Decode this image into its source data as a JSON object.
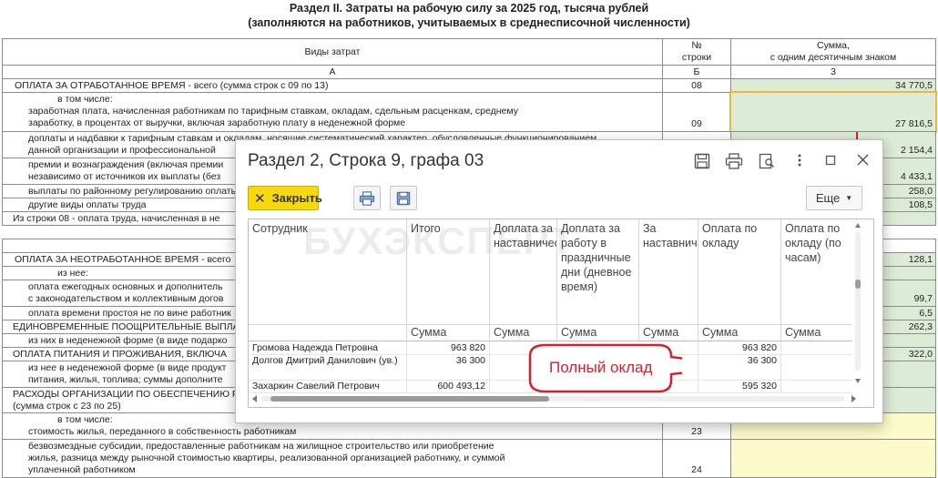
{
  "report": {
    "title_line1": "Раздел II. Затраты на рабочую силу за 2025 год, тысяча рублей",
    "title_line2": "(заполняются на работников, учитываемых в среднесписочной численности)",
    "header": {
      "col_a": "Виды затрат",
      "col_b_line1": "№",
      "col_b_line2": "строки",
      "col_c_line1": "Сумма,",
      "col_c_line2": "с одним десятичным знаком",
      "code_a": "А",
      "code_b": "Б",
      "code_c": "3"
    },
    "rows": {
      "r08": {
        "label": "ОПЛАТА ЗА ОТРАБОТАННОЕ ВРЕМЯ - всего (сумма строк с 09 по 13)",
        "code": "08",
        "value": "34 770,5"
      },
      "r_incl": "в том числе:",
      "r09_l1": "заработная плата, начисленная работникам по тарифным ставкам, окладам, сдельным расценкам, среднему",
      "r09_l2": "заработку, в процентах от выручки, включая заработную плату в неденежной форме",
      "r09_code": "09",
      "r09_value": "27 816,5",
      "r10_l1": "доплаты и надбавки к тарифным ставкам и окладам, носящие систематический характер, обусловленные функционированием",
      "r10_l2": "данной организации и профессиональной",
      "r10_value": "2 154,4",
      "r11_l1": "премии и вознаграждения (включая премии",
      "r11_l2": "независимо от источников их выплаты (без",
      "r11_value": "4 433,1",
      "r12": "выплаты по районному регулированию оплаты",
      "r12_value": "258,0",
      "r13": "другие виды оплаты труда",
      "r13_value": "108,5",
      "r14": "Из строки 08 - оплата труда, начисленная в не",
      "b2_r1": "ОПЛАТА ЗА НЕОТРАБОТАННОЕ ВРЕМЯ - всего",
      "b2_r1_value": "128,1",
      "b2_r2": "из нее:",
      "b2_r3_l1": "оплата ежегодных основных и дополнитель",
      "b2_r3_l2": "с законодательством и коллективным догов",
      "b2_r3_value": "99,7",
      "b2_r4": "оплата времени простоя не по вине работник",
      "b2_r4_value": "6,5",
      "b2_r5": "ЕДИНОВРЕМЕННЫЕ ПООЩРИТЕЛЬНЫЕ ВЫПЛАТ",
      "b2_r5_value": "262,3",
      "b2_r6": "из них в неденежной форме (в виде подарко",
      "b2_r7": "ОПЛАТА ПИТАНИЯ И ПРОЖИВАНИЯ, ВКЛЮЧА",
      "b2_r7_value": "322,0",
      "b2_r8_l1": "из нее в неденежной форме (в виде продукт",
      "b2_r8_l2": "питания, жилья, топлива; суммы дополните",
      "b2_r9_l1": "РАСХОДЫ ОРГАНИЗАЦИИ ПО ОБЕСПЕЧЕНИЮ Р",
      "b2_r9_l2": "(сумма строк с 23 по 25)",
      "b2_r10": "в том числе:",
      "b2_r11": "стоимость жилья, переданного в собственность работникам",
      "b2_r11_code": "23",
      "b2_r12_l1": "безвозмездные субсидии, предоставленные работникам на жилищное строительство или приобретение",
      "b2_r12_l2": "жилья, разница между рыночной стоимостью квартиры, реализованной организацией работнику, и суммой",
      "b2_r12_l3": "уплаченной работником",
      "b2_r12_code": "24"
    }
  },
  "modal": {
    "title": "Раздел 2, Строка 9, графа 03",
    "close_label": "Закрыть",
    "more_label": "Еще",
    "watermark": "БУХЭКСПЕРТ",
    "columns": [
      "Сотрудник",
      "Итого",
      "Доплата за наставничество",
      "Доплата за работу в праздничные дни (дневное время)",
      "За наставничество",
      "Оплата по окладу",
      "Оплата по окладу (по часам)"
    ],
    "subheaders": [
      "",
      "Сумма",
      "Сумма",
      "Сумма",
      "Сумма",
      "Сумма",
      "Сумма"
    ],
    "rows": [
      {
        "name": "Громова Надежда Петровна",
        "total": "963 820",
        "salary": "963 820"
      },
      {
        "name": "Долгов Дмитрий Данилович (ув.)",
        "total": "36 300",
        "salary": "36 300"
      },
      {
        "name": "Захаркин Савелий Петрович",
        "total": "600 493,12",
        "salary": "595 320"
      }
    ],
    "callout": "Полный оклад"
  },
  "colors": {
    "green_cell": "#dcebd5",
    "yellow_cell": "#fbfbc9",
    "highlight": "#f2b632",
    "close_button": "#f5d90d",
    "callout": "#d81f2a"
  }
}
